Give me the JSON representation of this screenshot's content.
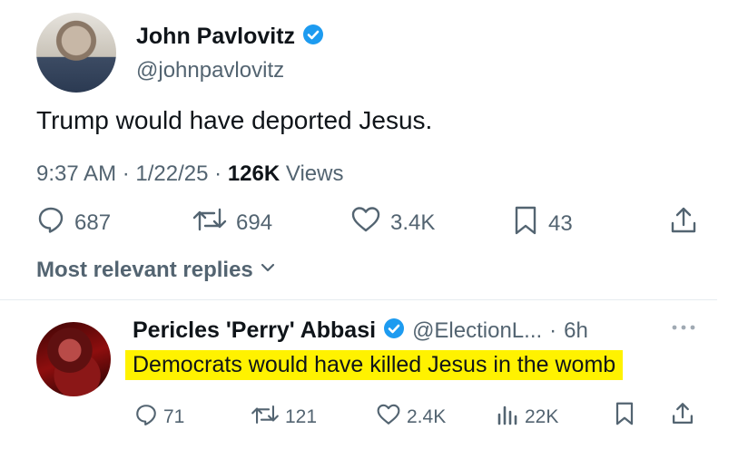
{
  "main_tweet": {
    "author_name": "John Pavlovitz",
    "author_handle": "@johnpavlovitz",
    "text": "Trump would have deported Jesus.",
    "time": "9:37 AM",
    "date": "1/22/25",
    "views_count": "126K",
    "views_label": "Views",
    "replies": "687",
    "reposts": "694",
    "likes": "3.4K",
    "bookmarks": "43"
  },
  "replies_filter": {
    "label": "Most relevant replies"
  },
  "reply": {
    "author_name": "Pericles 'Perry' Abbasi",
    "author_handle": "@ElectionL...",
    "age": "6h",
    "text": "Democrats would have killed Jesus in the womb",
    "replies": "71",
    "reposts": "121",
    "likes": "2.4K",
    "views": "22K"
  },
  "colors": {
    "verified": "#1d9bf0",
    "highlight": "#fff200",
    "muted_text": "#536471"
  }
}
